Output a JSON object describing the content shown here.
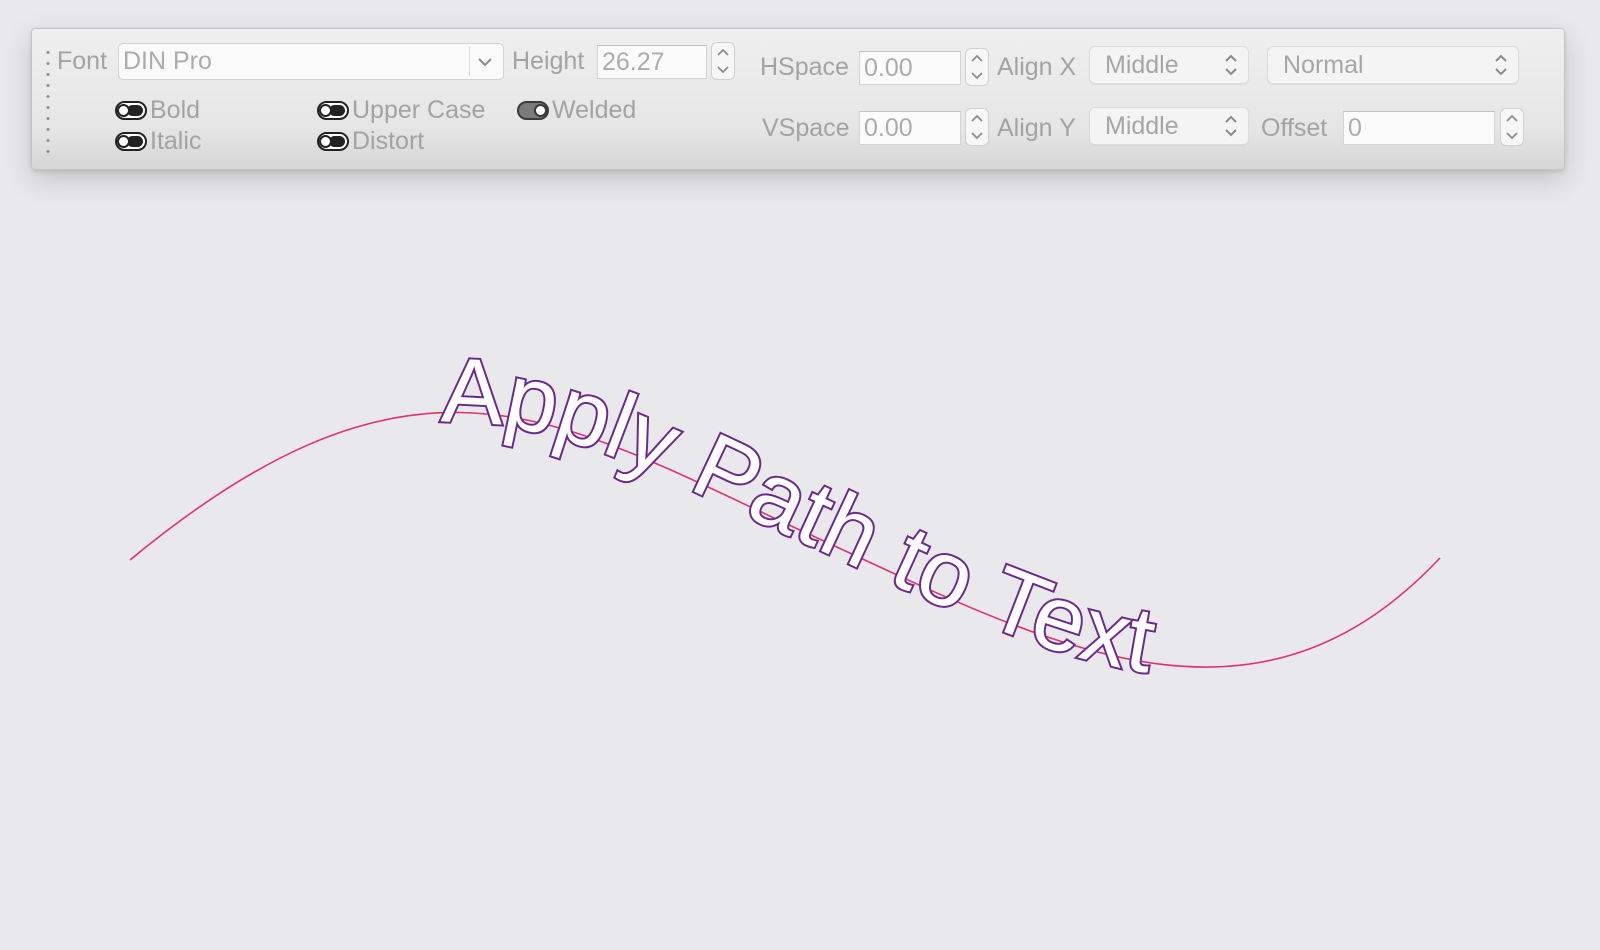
{
  "toolbar": {
    "font_label": "Font",
    "font_value": "DIN Pro",
    "height_label": "Height",
    "height_value": "26.27",
    "hspace_label": "HSpace",
    "hspace_value": "0.00",
    "vspace_label": "VSpace",
    "vspace_value": "0.00",
    "align_x_label": "Align X",
    "align_x_value": "Middle",
    "align_y_label": "Align Y",
    "align_y_value": "Middle",
    "mode_value": "Normal",
    "offset_label": "Offset",
    "offset_value": "0",
    "toggles": {
      "bold": {
        "label": "Bold",
        "on": false
      },
      "italic": {
        "label": "Italic",
        "on": false
      },
      "upper_case": {
        "label": "Upper Case",
        "on": false
      },
      "distort": {
        "label": "Distort",
        "on": false
      },
      "welded": {
        "label": "Welded",
        "on": true
      }
    }
  },
  "canvas": {
    "path_text": "Apply Path to Text",
    "path_color": "#e0336a",
    "text_outline_color": "#6a2a8c"
  }
}
